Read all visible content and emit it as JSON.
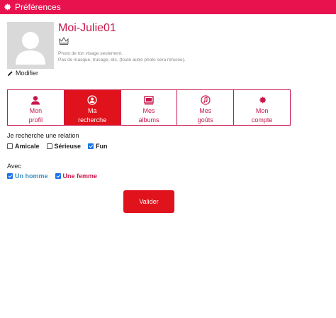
{
  "header": {
    "title": "Préférences",
    "icon": "gear-icon",
    "color": "#e8124f"
  },
  "profile": {
    "username": "Moi-Julie01",
    "modify_label": "Modifier",
    "hint_line1": "Photo de ton visage seulement.",
    "hint_line2": "Pas de masque, trucage, etc. (toute autre photo sera refusée)."
  },
  "tabs": [
    {
      "l1": "Mon",
      "l2": "profil",
      "icon": "user-icon",
      "active": false
    },
    {
      "l1": "Ma",
      "l2": "recherche",
      "icon": "search-user-icon",
      "active": true
    },
    {
      "l1": "Mes",
      "l2": "albums",
      "icon": "album-icon",
      "active": false
    },
    {
      "l1": "Mes",
      "l2": "goûts",
      "icon": "music-icon",
      "active": false
    },
    {
      "l1": "Mon",
      "l2": "compte",
      "icon": "gear-icon",
      "active": false
    }
  ],
  "relation": {
    "label": "Je recherche une relation",
    "options": [
      {
        "label": "Amicale",
        "checked": false
      },
      {
        "label": "Sérieuse",
        "checked": false
      },
      {
        "label": "Fun",
        "checked": true
      }
    ]
  },
  "with": {
    "label": "Avec",
    "options": [
      {
        "label": "Un homme",
        "checked": true
      },
      {
        "label": "Une femme",
        "checked": true
      }
    ]
  },
  "submit_label": "Valider",
  "colors": {
    "accent": "#e0121c",
    "brand": "#c8174b",
    "man": "#3a8fc4"
  }
}
